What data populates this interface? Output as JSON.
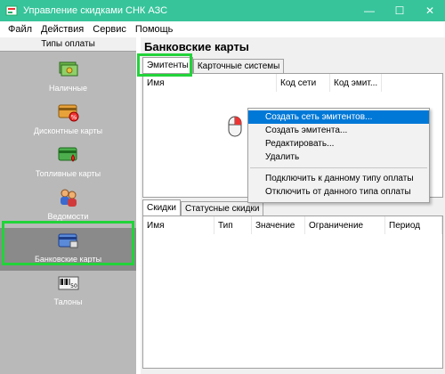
{
  "window": {
    "title": "Управление скидками СНК АЗС",
    "minimize": "—",
    "maximize": "☐",
    "close": "✕"
  },
  "menubar": {
    "items": [
      "Файл",
      "Действия",
      "Сервис",
      "Помощь"
    ]
  },
  "left_panel": {
    "header": "Типы оплаты",
    "items": [
      {
        "label": "Наличные",
        "icon": "cash-icon"
      },
      {
        "label": "Дисконтные карты",
        "icon": "discount-card-icon"
      },
      {
        "label": "Топливные карты",
        "icon": "fuel-card-icon"
      },
      {
        "label": "Ведомости",
        "icon": "statement-icon"
      },
      {
        "label": "Банковские карты",
        "icon": "bank-card-icon",
        "selected": true
      },
      {
        "label": "Талоны",
        "icon": "coupon-icon"
      }
    ]
  },
  "right_panel": {
    "title": "Банковские карты",
    "top_tabs": [
      "Эмитенты",
      "Карточные системы"
    ],
    "top_columns": [
      "Имя",
      "Код сети",
      "Код эмит..."
    ],
    "bottom_tabs": [
      "Скидки",
      "Статусные скидки"
    ],
    "bottom_columns": [
      "Имя",
      "Тип",
      "Значение",
      "Ограничение",
      "Период"
    ]
  },
  "context_menu": {
    "items": [
      {
        "label": "Создать сеть эмитентов...",
        "hover": true
      },
      {
        "label": "Создать эмитента..."
      },
      {
        "label": "Редактировать..."
      },
      {
        "label": "Удалить"
      },
      {
        "label": "Подключить к данному типу оплаты"
      },
      {
        "label": "Отключить от данного типа оплаты"
      }
    ]
  },
  "colors": {
    "titlebar": "#37c49b",
    "highlight": "#22d33a",
    "menu_hover": "#0078d7",
    "left_panel": "#b9b9b9"
  }
}
